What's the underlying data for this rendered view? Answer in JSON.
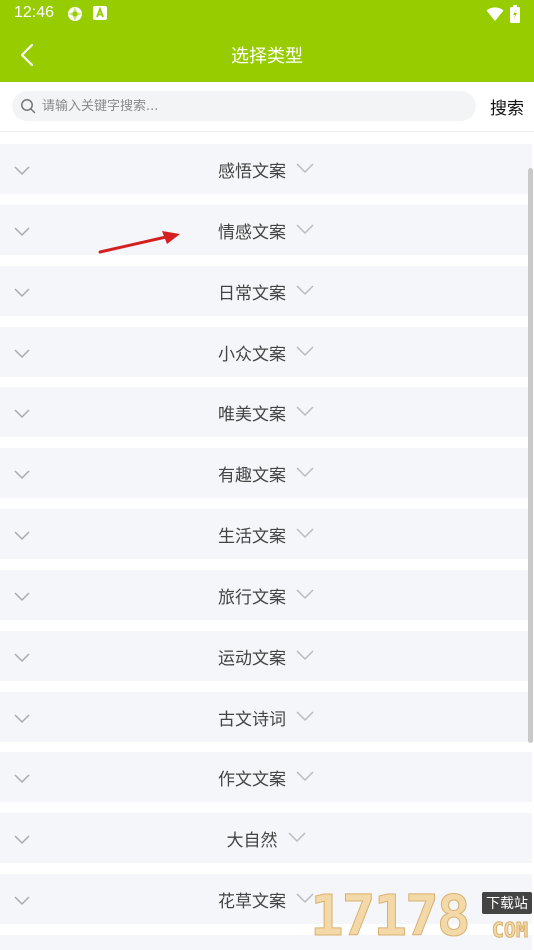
{
  "status_bar": {
    "time": "12:46",
    "icons": [
      "settings-flower-icon",
      "a-badge-icon",
      "wifi-icon",
      "battery-icon"
    ]
  },
  "header": {
    "title": "选择类型",
    "back_icon": "chevron-left-icon",
    "color": "#96cc00"
  },
  "search": {
    "placeholder": "请输入关键字搜索...",
    "value": "",
    "button_label": "搜索"
  },
  "categories": [
    {
      "label": "感悟文案"
    },
    {
      "label": "情感文案"
    },
    {
      "label": "日常文案"
    },
    {
      "label": "小众文案"
    },
    {
      "label": "唯美文案"
    },
    {
      "label": "有趣文案"
    },
    {
      "label": "生活文案"
    },
    {
      "label": "旅行文案"
    },
    {
      "label": "运动文案"
    },
    {
      "label": "古文诗词"
    },
    {
      "label": "作文文案"
    },
    {
      "label": "大自然"
    },
    {
      "label": "花草文案"
    }
  ],
  "watermark": {
    "digits": "17178",
    "badge": "下载站",
    "suffix": "COM"
  }
}
